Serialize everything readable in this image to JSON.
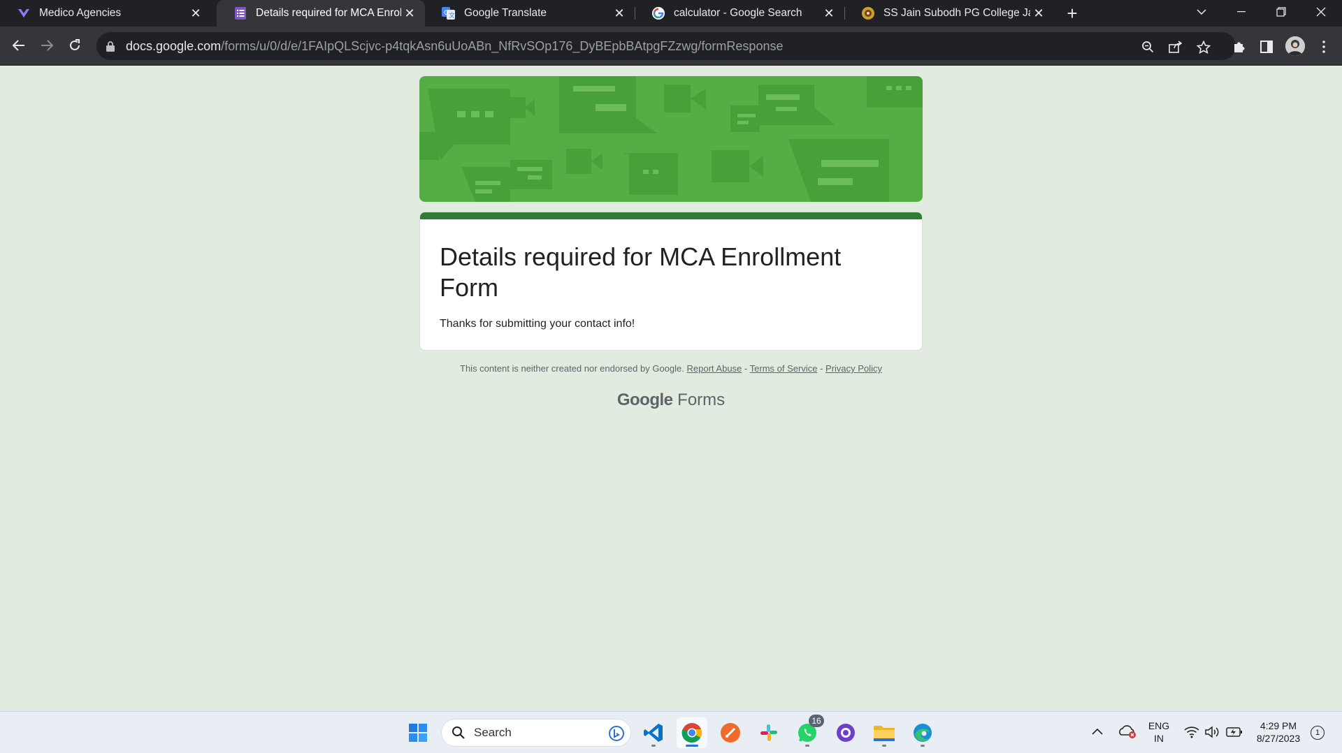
{
  "browser": {
    "tabs": [
      {
        "title": "Medico Agencies",
        "icon": "heart-logo-icon",
        "active": false
      },
      {
        "title": "Details required for MCA Enrollment Form",
        "icon": "google-forms-icon",
        "active": true
      },
      {
        "title": "Google Translate",
        "icon": "google-translate-icon",
        "active": false
      },
      {
        "title": "calculator - Google Search",
        "icon": "google-g-icon",
        "active": false
      },
      {
        "title": "SS Jain Subodh PG College Jaipur",
        "icon": "college-logo-icon",
        "active": false
      }
    ],
    "close_glyph": "✕",
    "new_tab_glyph": "+",
    "url_host": "docs.google.com",
    "url_path": "/forms/u/0/d/e/1FAIpQLScjvc-p4tqkAsn6uUoABn_NfRvSOp176_DyBEpbBAtpgFZzwg/formResponse"
  },
  "form": {
    "title": "Details required for MCA Enrollment Form",
    "message": "Thanks for submitting your contact info!",
    "theme_color": "#2e7d32",
    "banner_color": "#55ad44",
    "page_background": "#e2ebe0"
  },
  "footer": {
    "disclaimer": "This content is neither created nor endorsed by Google.",
    "report_abuse": "Report Abuse",
    "separator": "-",
    "terms": "Terms of Service",
    "privacy": "Privacy Policy",
    "brand_google": "Google",
    "brand_product": "Forms"
  },
  "taskbar": {
    "search_placeholder": "Search",
    "apps": [
      "windows-start-icon",
      "vscode-icon",
      "chrome-icon",
      "brave-like-orange-icon",
      "slack-icon",
      "whatsapp-icon",
      "github-desktop-icon",
      "file-explorer-icon",
      "edge-icon"
    ],
    "whatsapp_badge": "16",
    "language_line1": "ENG",
    "language_line2": "IN",
    "time": "4:29 PM",
    "date": "8/27/2023",
    "notification_count": "1"
  }
}
